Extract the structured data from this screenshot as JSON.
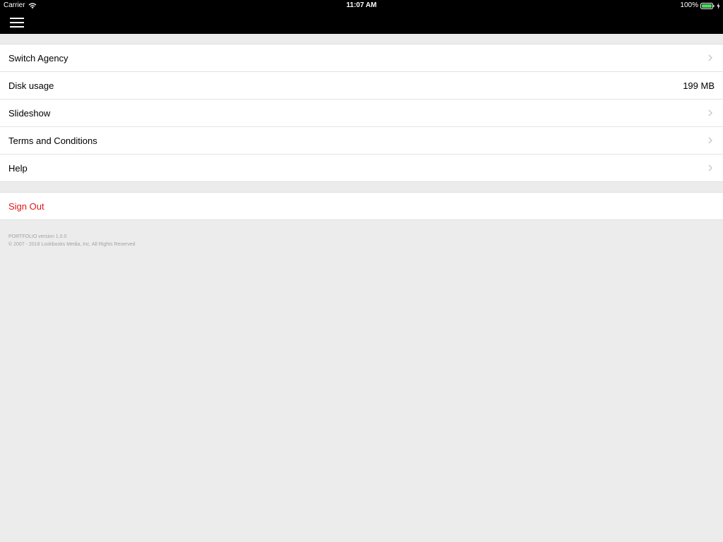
{
  "status_bar": {
    "carrier": "Carrier",
    "time": "11:07 AM",
    "battery_percent": "100%",
    "battery_color": "#4cd964"
  },
  "navbar": {
    "menu_icon": "hamburger-menu-icon"
  },
  "settings": {
    "items": [
      {
        "label": "Switch Agency",
        "icon": "chevron-right-icon"
      },
      {
        "label": "Disk usage",
        "value": "199 MB"
      },
      {
        "label": "Slideshow",
        "icon": "chevron-right-icon"
      },
      {
        "label": "Terms and Conditions",
        "icon": "chevron-right-icon"
      },
      {
        "label": "Help",
        "icon": "chevron-right-icon"
      }
    ],
    "sign_out": {
      "label": "Sign Out",
      "color": "#e21616"
    }
  },
  "footer": {
    "version": "PORTFOLIO version 1.0.0",
    "copyright": "© 2007 - 2018 Lookbooks Media, Inc. All Rights Reserved"
  }
}
